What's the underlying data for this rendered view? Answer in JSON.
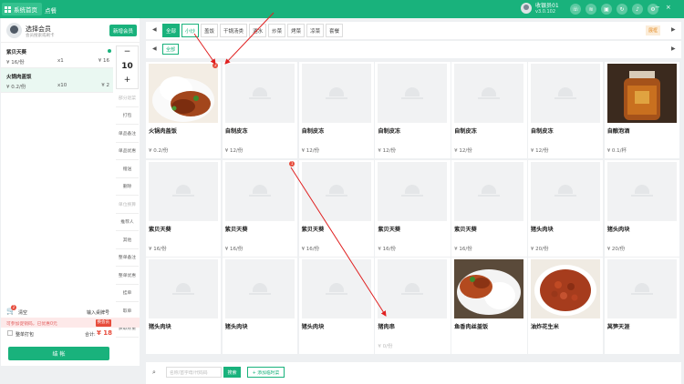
{
  "topbar": {
    "home_label": "系统首页",
    "tab": "点餐",
    "user_name": "收银员01",
    "user_sub": "v3.0.102",
    "icons": [
      "headset-icon",
      "wifi-icon",
      "lock-icon",
      "refresh-icon",
      "bell-icon",
      "settings-icon"
    ]
  },
  "member": {
    "name": "选择会员",
    "sub": "会员搜索或刷卡",
    "open_button": "新增会员"
  },
  "orders": [
    {
      "name": "紫贝天葵",
      "price": "¥ 16/份",
      "qty": "x1",
      "total": "¥ 16"
    },
    {
      "name": "火锅肉盖饭",
      "price": "¥ 0.2/份",
      "qty": "x10",
      "total": "¥ 2"
    }
  ],
  "stepper": {
    "minus": "−",
    "value": "10",
    "plus": "+"
  },
  "ops": [
    {
      "label": "部分退菜",
      "disabled": true
    },
    {
      "label": "打包",
      "disabled": false
    },
    {
      "label": "单品备注",
      "disabled": false
    },
    {
      "label": "单品优惠",
      "disabled": false
    },
    {
      "label": "赠送",
      "disabled": false
    },
    {
      "label": "删除",
      "disabled": false
    },
    {
      "label": "单位换算",
      "disabled": true
    },
    {
      "label": "推荐人",
      "disabled": false
    },
    {
      "label": "其他",
      "disabled": false
    },
    {
      "label": "整单备注",
      "disabled": false
    },
    {
      "label": "整单优惠",
      "disabled": false
    },
    {
      "label": "挂单",
      "disabled": false
    },
    {
      "label": "取单",
      "disabled": false
    },
    {
      "label": "获取称重",
      "disabled": false
    }
  ],
  "cart": {
    "badge": "2",
    "clear_label": "清空",
    "table_label": "输入桌牌号"
  },
  "hint": {
    "text": "可参加促销码，已优惠0元",
    "button": "换会员"
  },
  "pack": {
    "label": "整单打包",
    "total_label": "合计:",
    "total_value": "¥ 18"
  },
  "checkout_label": "结 帐",
  "categories": [
    {
      "label": "全部",
      "state": "active"
    },
    {
      "label": "小炒",
      "state": "highlight"
    },
    {
      "label": "盖饭",
      "state": ""
    },
    {
      "label": "干锅汤类",
      "state": ""
    },
    {
      "label": "酒水",
      "state": ""
    },
    {
      "label": "炒菜",
      "state": ""
    },
    {
      "label": "烤菜",
      "state": ""
    },
    {
      "label": "凉菜",
      "state": ""
    },
    {
      "label": "套餐",
      "state": ""
    }
  ],
  "view_toggle": "展框",
  "sub_category": "全部",
  "products": [
    {
      "name": "火锅肉盖饭",
      "price": "¥ 0.2/份",
      "img": "rice-chicken",
      "badge": "2"
    },
    {
      "name": "自制皮冻",
      "price": "¥ 12/份",
      "img": "placeholder",
      "badge": ""
    },
    {
      "name": "自制皮冻",
      "price": "¥ 12/份",
      "img": "placeholder",
      "badge": ""
    },
    {
      "name": "自制皮冻",
      "price": "¥ 12/份",
      "img": "placeholder",
      "badge": ""
    },
    {
      "name": "自制皮冻",
      "price": "¥ 12/份",
      "img": "placeholder",
      "badge": ""
    },
    {
      "name": "自制皮冻",
      "price": "¥ 12/份",
      "img": "placeholder",
      "badge": ""
    },
    {
      "name": "自酿泡酒",
      "price": "¥ 0.1/杯",
      "img": "wine",
      "badge": ""
    },
    {
      "name": "紫贝天葵",
      "price": "¥ 16/份",
      "img": "placeholder",
      "badge": ""
    },
    {
      "name": "紫贝天葵",
      "price": "¥ 16/份",
      "img": "placeholder",
      "badge": "1"
    },
    {
      "name": "紫贝天葵",
      "price": "¥ 16/份",
      "img": "placeholder",
      "badge": ""
    },
    {
      "name": "紫贝天葵",
      "price": "¥ 16/份",
      "img": "placeholder",
      "badge": ""
    },
    {
      "name": "紫贝天葵",
      "price": "¥ 16/份",
      "img": "placeholder",
      "badge": ""
    },
    {
      "name": "猪头肉块",
      "price": "¥ 20/份",
      "img": "placeholder",
      "badge": ""
    },
    {
      "name": "猪头肉块",
      "price": "¥ 20/份",
      "img": "placeholder",
      "badge": ""
    },
    {
      "name": "猪头肉块",
      "price": "",
      "img": "placeholder",
      "badge": ""
    },
    {
      "name": "猪头肉块",
      "price": "",
      "img": "placeholder",
      "badge": ""
    },
    {
      "name": "猪头肉块",
      "price": "",
      "img": "placeholder",
      "badge": ""
    },
    {
      "name": "猪肉串",
      "price": "¥ 0/份",
      "img": "placeholder",
      "badge": ""
    },
    {
      "name": "鱼香肉丝盖饭",
      "price": "",
      "img": "rice-pork",
      "badge": ""
    },
    {
      "name": "油炸花生米",
      "price": "",
      "img": "peanuts",
      "badge": ""
    },
    {
      "name": "莴笋天涯",
      "price": "",
      "img": "placeholder",
      "badge": ""
    }
  ],
  "search": {
    "placeholder": "名称/首字母/代码码",
    "button": "搜索",
    "add_button": "+ 添加临时菜"
  },
  "colors": {
    "brand": "#19b27c",
    "danger": "#e74c3c",
    "annotation": "#e02020"
  }
}
